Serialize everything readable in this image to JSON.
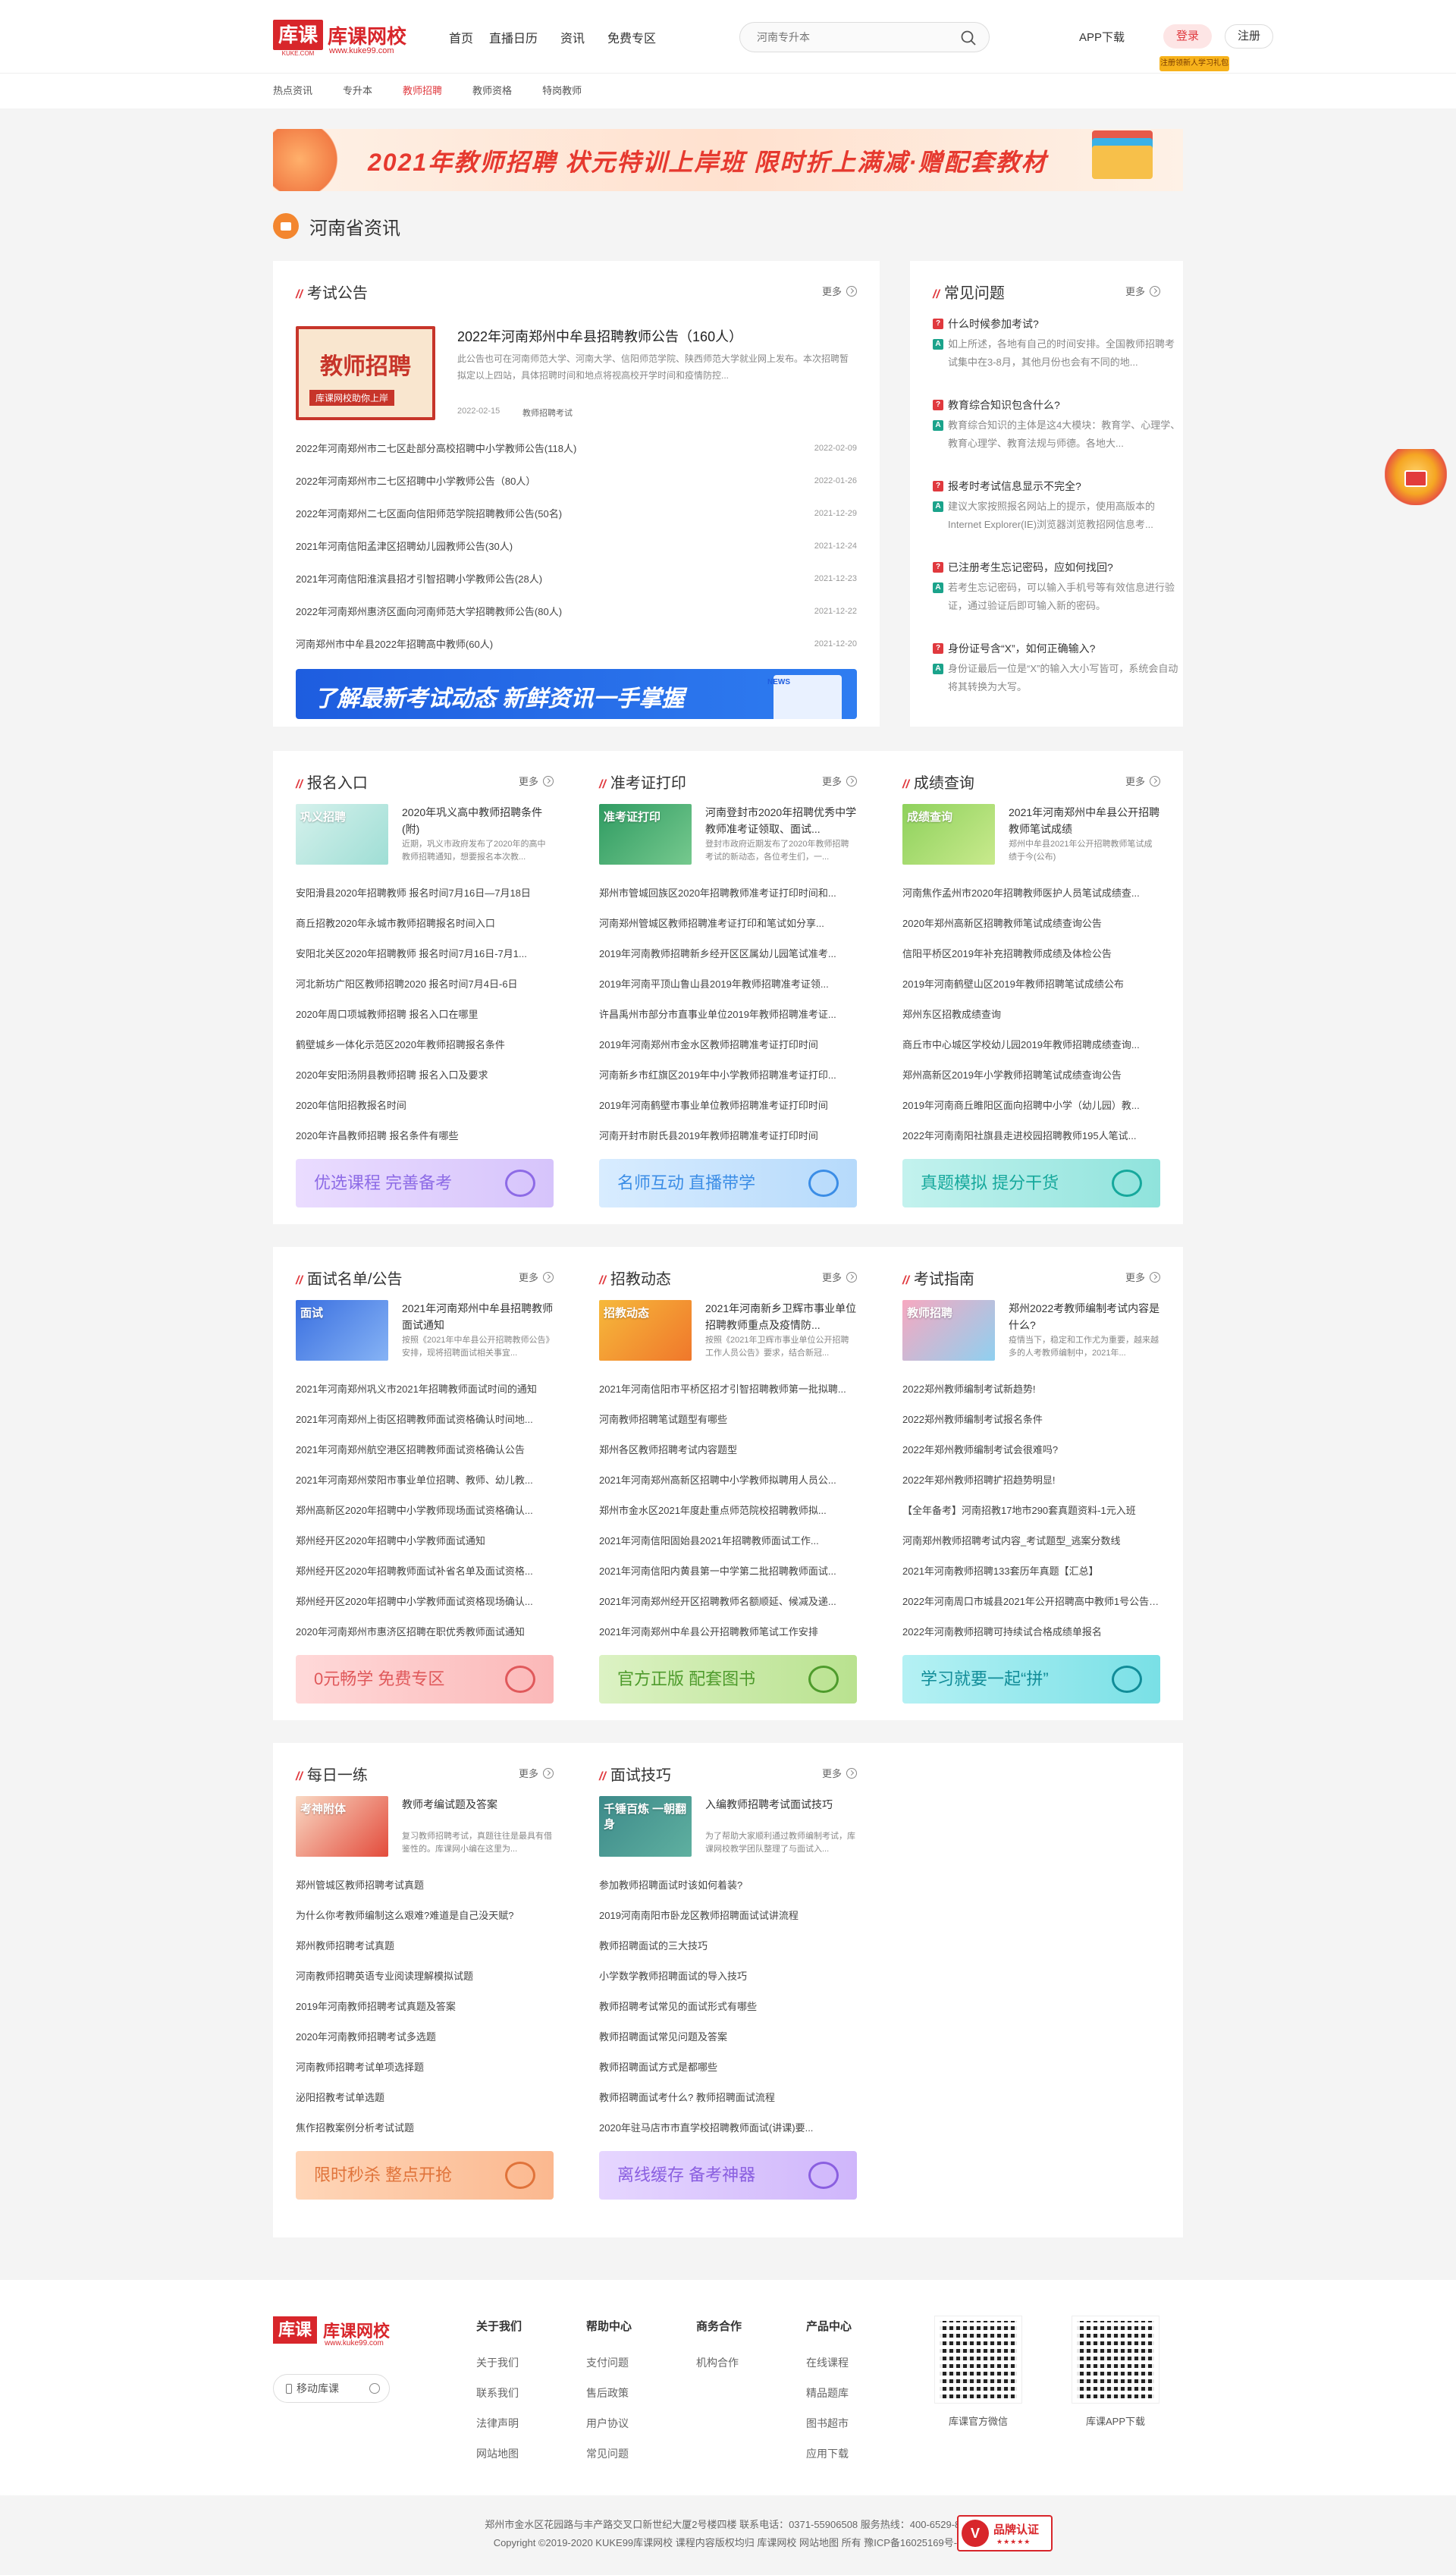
{
  "header": {
    "logo_mark": "库课",
    "logo_mark_sub": "KUKE.COM",
    "logo_name": "库课网校",
    "logo_url": "www.kuke99.com",
    "nav": [
      "首页",
      "直播日历",
      "资讯",
      "免费专区"
    ],
    "search_placeholder": "河南专升本",
    "app_download": "APP下载",
    "login": "登录",
    "register": "注册",
    "promo_tag": "注册领新人学习礼包"
  },
  "subnav": [
    "热点资讯",
    "专升本",
    "教师招聘",
    "教师资格",
    "特岗教师"
  ],
  "subnav_active": 2,
  "banner": {
    "text": "2021年教师招聘   状元特训上岸班   限时折上满减·赠配套教材"
  },
  "section_title": "河南省资讯",
  "exam_notice": {
    "title": "考试公告",
    "more": "更多",
    "featured": {
      "thumb_text": "教师招聘",
      "thumb_sub": "库课网校助你上岸",
      "title": "2022年河南郑州中牟县招聘教师公告（160人）",
      "desc": "此公告也可在河南师范大学、河南大学、信阳师范学院、陕西师范大学就业网上发布。本次招聘暂拟定以上四站，具体招聘时间和地点将视高校开学时间和疫情防控...",
      "date": "2022-02-15",
      "tag": "教师招聘考试"
    },
    "items": [
      {
        "t": "2022年河南郑州市二七区赴部分高校招聘中小学教师公告(118人)",
        "d": "2022-02-09"
      },
      {
        "t": "2022年河南郑州市二七区招聘中小学教师公告（80人）",
        "d": "2022-01-26"
      },
      {
        "t": "2022年河南郑州二七区面向信阳师范学院招聘教师公告(50名)",
        "d": "2021-12-29"
      },
      {
        "t": "2021年河南信阳孟津区招聘幼儿园教师公告(30人)",
        "d": "2021-12-24"
      },
      {
        "t": "2021年河南信阳淮滨县招才引智招聘小学教师公告(28人)",
        "d": "2021-12-23"
      },
      {
        "t": "2022年河南郑州惠济区面向河南师范大学招聘教师公告(80人)",
        "d": "2021-12-22"
      },
      {
        "t": "河南郑州市中牟县2022年招聘高中教师(60人)",
        "d": "2021-12-20"
      }
    ],
    "ad_text": "了解最新考试动态  新鲜资讯一手掌握",
    "ad_badge": "NEWS"
  },
  "faq": {
    "title": "常见问题",
    "more": "更多",
    "items": [
      {
        "q": "什么时候参加考试?",
        "a": "如上所述，各地有自己的时间安排。全国教师招聘考试集中在3-8月，其他月份也会有不同的地..."
      },
      {
        "q": "教育综合知识包含什么?",
        "a": "教育综合知识的主体是这4大模块：教育学、心理学、教育心理学、教育法规与师德。各地大..."
      },
      {
        "q": "报考时考试信息显示不完全?",
        "a": "建议大家按照报名网站上的提示，使用高版本的Internet Explorer(IE)浏览器浏览教招网信息考..."
      },
      {
        "q": "已注册考生忘记密码，应如何找回?",
        "a": "若考生忘记密码，可以输入手机号等有效信息进行验证，通过验证后即可输入新的密码。"
      },
      {
        "q": "身份证号含“X”，如何正确输入?",
        "a": "身份证最后一位是“X”的输入大小写皆可，系统会自动将其转换为大写。"
      }
    ]
  },
  "cols_row1": [
    {
      "title": "报名入口",
      "more": "更多",
      "thumb_text": "巩义招聘",
      "feat_t": "2020年巩义高中教师招聘条件(附)",
      "feat_d": "近期，巩义市政府发布了2020年的高中教师招聘通知，想要报名本次教...",
      "items": [
        "安阳滑县2020年招聘教师 报名时间7月16日—7月18日",
        "商丘招教2020年永城市教师招聘报名时间入口",
        "安阳北关区2020年招聘教师 报名时间7月16日-7月1...",
        "河北新坊广阳区教师招聘2020 报名时间7月4日-6日",
        "2020年周口项城教师招聘 报名入口在哪里",
        "鹤壁城乡一体化示范区2020年教师招聘报名条件",
        "2020年安阳汤阴县教师招聘 报名入口及要求",
        "2020年信阳招教报名时间",
        "2020年许昌教师招聘 报名条件有哪些"
      ],
      "btn": "优选课程 完善备考"
    },
    {
      "title": "准考证打印",
      "more": "更多",
      "thumb_text": "准考证打印",
      "feat_t": "河南登封市2020年招聘优秀中学教师准考证领取、面试...",
      "feat_d": "登封市政府近期发布了2020年教师招聘考试的新动态，各位考生们，一...",
      "items": [
        "郑州市管城回族区2020年招聘教师准考证打印时间和...",
        "河南郑州管城区教师招聘准考证打印和笔试如分享...",
        "2019年河南教师招聘新乡经开区区属幼儿园笔试准考...",
        "2019年河南平顶山鲁山县2019年教师招聘准考证领...",
        "许昌禹州市部分市直事业单位2019年教师招聘准考证...",
        "2019年河南郑州市金水区教师招聘准考证打印时间",
        "河南新乡市红旗区2019年中小学教师招聘准考证打印...",
        "2019年河南鹤壁市事业单位教师招聘准考证打印时间",
        "河南开封市尉氏县2019年教师招聘准考证打印时间"
      ],
      "btn": "名师互动 直播带学"
    },
    {
      "title": "成绩查询",
      "more": "更多",
      "thumb_text": "成绩查询",
      "feat_t": "2021年河南郑州中牟县公开招聘教师笔试成绩",
      "feat_d": "郑州中牟县2021年公开招聘教师笔试成绩于今(公布)",
      "items": [
        "河南焦作孟州市2020年招聘教师医护人员笔试成绩查...",
        "2020年郑州高新区招聘教师笔试成绩查询公告",
        "信阳平桥区2019年补充招聘教师成绩及体检公告",
        "2019年河南鹤壁山区2019年教师招聘笔试成绩公布",
        "郑州东区招教成绩查询",
        "商丘市中心城区学校幼儿园2019年教师招聘成绩查询...",
        "郑州高新区2019年小学教师招聘笔试成绩查询公告",
        "2019年河南商丘睢阳区面向招聘中小学（幼儿园）教...",
        "2022年河南南阳社旗县走进校园招聘教师195人笔试..."
      ],
      "btn": "真题模拟 提分干货"
    }
  ],
  "cols_row2": [
    {
      "title": "面试名单/公告",
      "more": "更多",
      "thumb_text": "面试",
      "feat_t": "2021年河南郑州中牟县招聘教师面试通知",
      "feat_d": "按照《2021年中牟县公开招聘教师公告》安排，现将招聘面试相关事宜...",
      "items": [
        "2021年河南郑州巩义市2021年招聘教师面试时间的通知",
        "2021年河南郑州上街区招聘教师面试资格确认时间地...",
        "2021年河南郑州航空港区招聘教师面试资格确认公告",
        "2021年河南郑州荥阳市事业单位招聘、教师、幼儿教...",
        "郑州高新区2020年招聘中小学教师现场面试资格确认...",
        "郑州经开区2020年招聘中小学教师面试通知",
        "郑州经开区2020年招聘教师面试补省名单及面试资格...",
        "郑州经开区2020年招聘中小学教师面试资格现场确认...",
        "2020年河南郑州市惠济区招聘在职优秀教师面试通知"
      ],
      "btn": "0元畅学 免费专区"
    },
    {
      "title": "招教动态",
      "more": "更多",
      "thumb_text": "招教动态",
      "feat_t": "2021年河南新乡卫辉市事业单位招聘教师重点及疫情防...",
      "feat_d": "按照《2021年卫辉市事业单位公开招聘工作人员公告》要求，结合新冠...",
      "items": [
        "2021年河南信阳市平桥区招才引智招聘教师第一批拟聘...",
        "河南教师招聘笔试题型有哪些",
        "郑州各区教师招聘考试内容题型",
        "2021年河南郑州高新区招聘中小学教师拟聘用人员公...",
        "郑州市金水区2021年度赴重点师范院校招聘教师拟...",
        "2021年河南信阳固始县2021年招聘教师面试工作...",
        "2021年河南信阳内黄县第一中学第二批招聘教师面试...",
        "2021年河南郑州经开区招聘教师名额顺延、候减及递...",
        "2021年河南郑州中牟县公开招聘教师笔试工作安排"
      ],
      "btn": "官方正版 配套图书"
    },
    {
      "title": "考试指南",
      "more": "更多",
      "thumb_text": "教师招聘",
      "feat_t": "郑州2022考教师编制考试内容是什么?",
      "feat_d": "疫情当下，稳定和工作尤为重要，越来越多的人考教师编制中，2021年...",
      "items": [
        "2022郑州教师编制考试新趋势!",
        "2022郑州教师编制考试报名条件",
        "2022年郑州教师编制考试会很难吗?",
        "2022年郑州教师招聘扩招趋势明显!",
        "【全年备考】河南招教17地市290套真题资料-1元入班",
        "河南郑州教师招聘考试内容_考试题型_逃案分数线",
        "2021年河南教师招聘133套历年真题【汇总】",
        "2022年河南周口市城县2021年公开招聘高中教师1号公告(时...",
        "2022年河南教师招聘可持续试合格成绩单报名"
      ],
      "btn": "学习就要一起“拼”"
    }
  ],
  "cols_row3": [
    {
      "title": "每日一练",
      "more": "更多",
      "thumb_text": "考神附体",
      "feat_t": "教师考编试题及答案",
      "feat_d": "复习教师招聘考试，真题往往是最具有借鉴性的。库课网小编在这里为...",
      "items": [
        "郑州管城区教师招聘考试真题",
        "为什么你考教师编制这么艰难?难道是自己没天赋?",
        "郑州教师招聘考试真题",
        "河南教师招聘英语专业阅读理解模拟试题",
        "2019年河南教师招聘考试真题及答案",
        "2020年河南教师招聘考试多选题",
        "河南教师招聘考试单项选择题",
        "泌阳招教考试单选题",
        "焦作招教案例分析考试试题"
      ],
      "btn": "限时秒杀 整点开抢"
    },
    {
      "title": "面试技巧",
      "more": "更多",
      "thumb_text": "千锤百炼 一朝翻身",
      "feat_t": "入编教师招聘考试面试技巧",
      "feat_d": "为了帮助大家顺利通过教师编制考试，库课网校教学团队整理了与面试入...",
      "items": [
        "参加教师招聘面试时该如何着装?",
        "2019河南南阳市卧龙区教师招聘面试试讲流程",
        "教师招聘面试的三大技巧",
        "小学数学教师招聘面试的导入技巧",
        "教师招聘考试常见的面试形式有哪些",
        "教师招聘面试常见问题及答案",
        "教师招聘面试方式是都哪些",
        "教师招聘面试考什么? 教师招聘面试流程",
        "2020年驻马店市市直学校招聘教师面试(讲课)要..."
      ],
      "btn": "离线缓存 备考神器"
    }
  ],
  "footer": {
    "logo_mark": "库课",
    "logo_name": "库课网校",
    "logo_url": "www.kuke99.com",
    "mobile": "移动库课",
    "columns": [
      {
        "h": "关于我们",
        "items": [
          "关于我们",
          "联系我们",
          "法律声明",
          "网站地图"
        ]
      },
      {
        "h": "帮助中心",
        "items": [
          "支付问题",
          "售后政策",
          "用户协议",
          "常见问题"
        ]
      },
      {
        "h": "商务合作",
        "items": [
          "机构合作"
        ]
      },
      {
        "h": "产品中心",
        "items": [
          "在线课程",
          "精品题库",
          "图书超市",
          "应用下载"
        ]
      }
    ],
    "qr1": "库课官方微信",
    "qr2": "库课APP下载"
  },
  "bottom": {
    "line1": "郑州市金水区花园路与丰产路交叉口新世纪大厦2号楼四楼  联系电话：0371-55906508  服务热线：400-6529-888",
    "line2": "Copyright ©2019-2020 KUKE99库课网校 课程内容版权均归 库课网校 网站地图 所有 豫ICP备16025169号-1",
    "badge": "品牌认证",
    "badge_stars": "★★★★★"
  },
  "colors": {
    "brand_red": "#d8262b",
    "accent": "#e0393e"
  }
}
